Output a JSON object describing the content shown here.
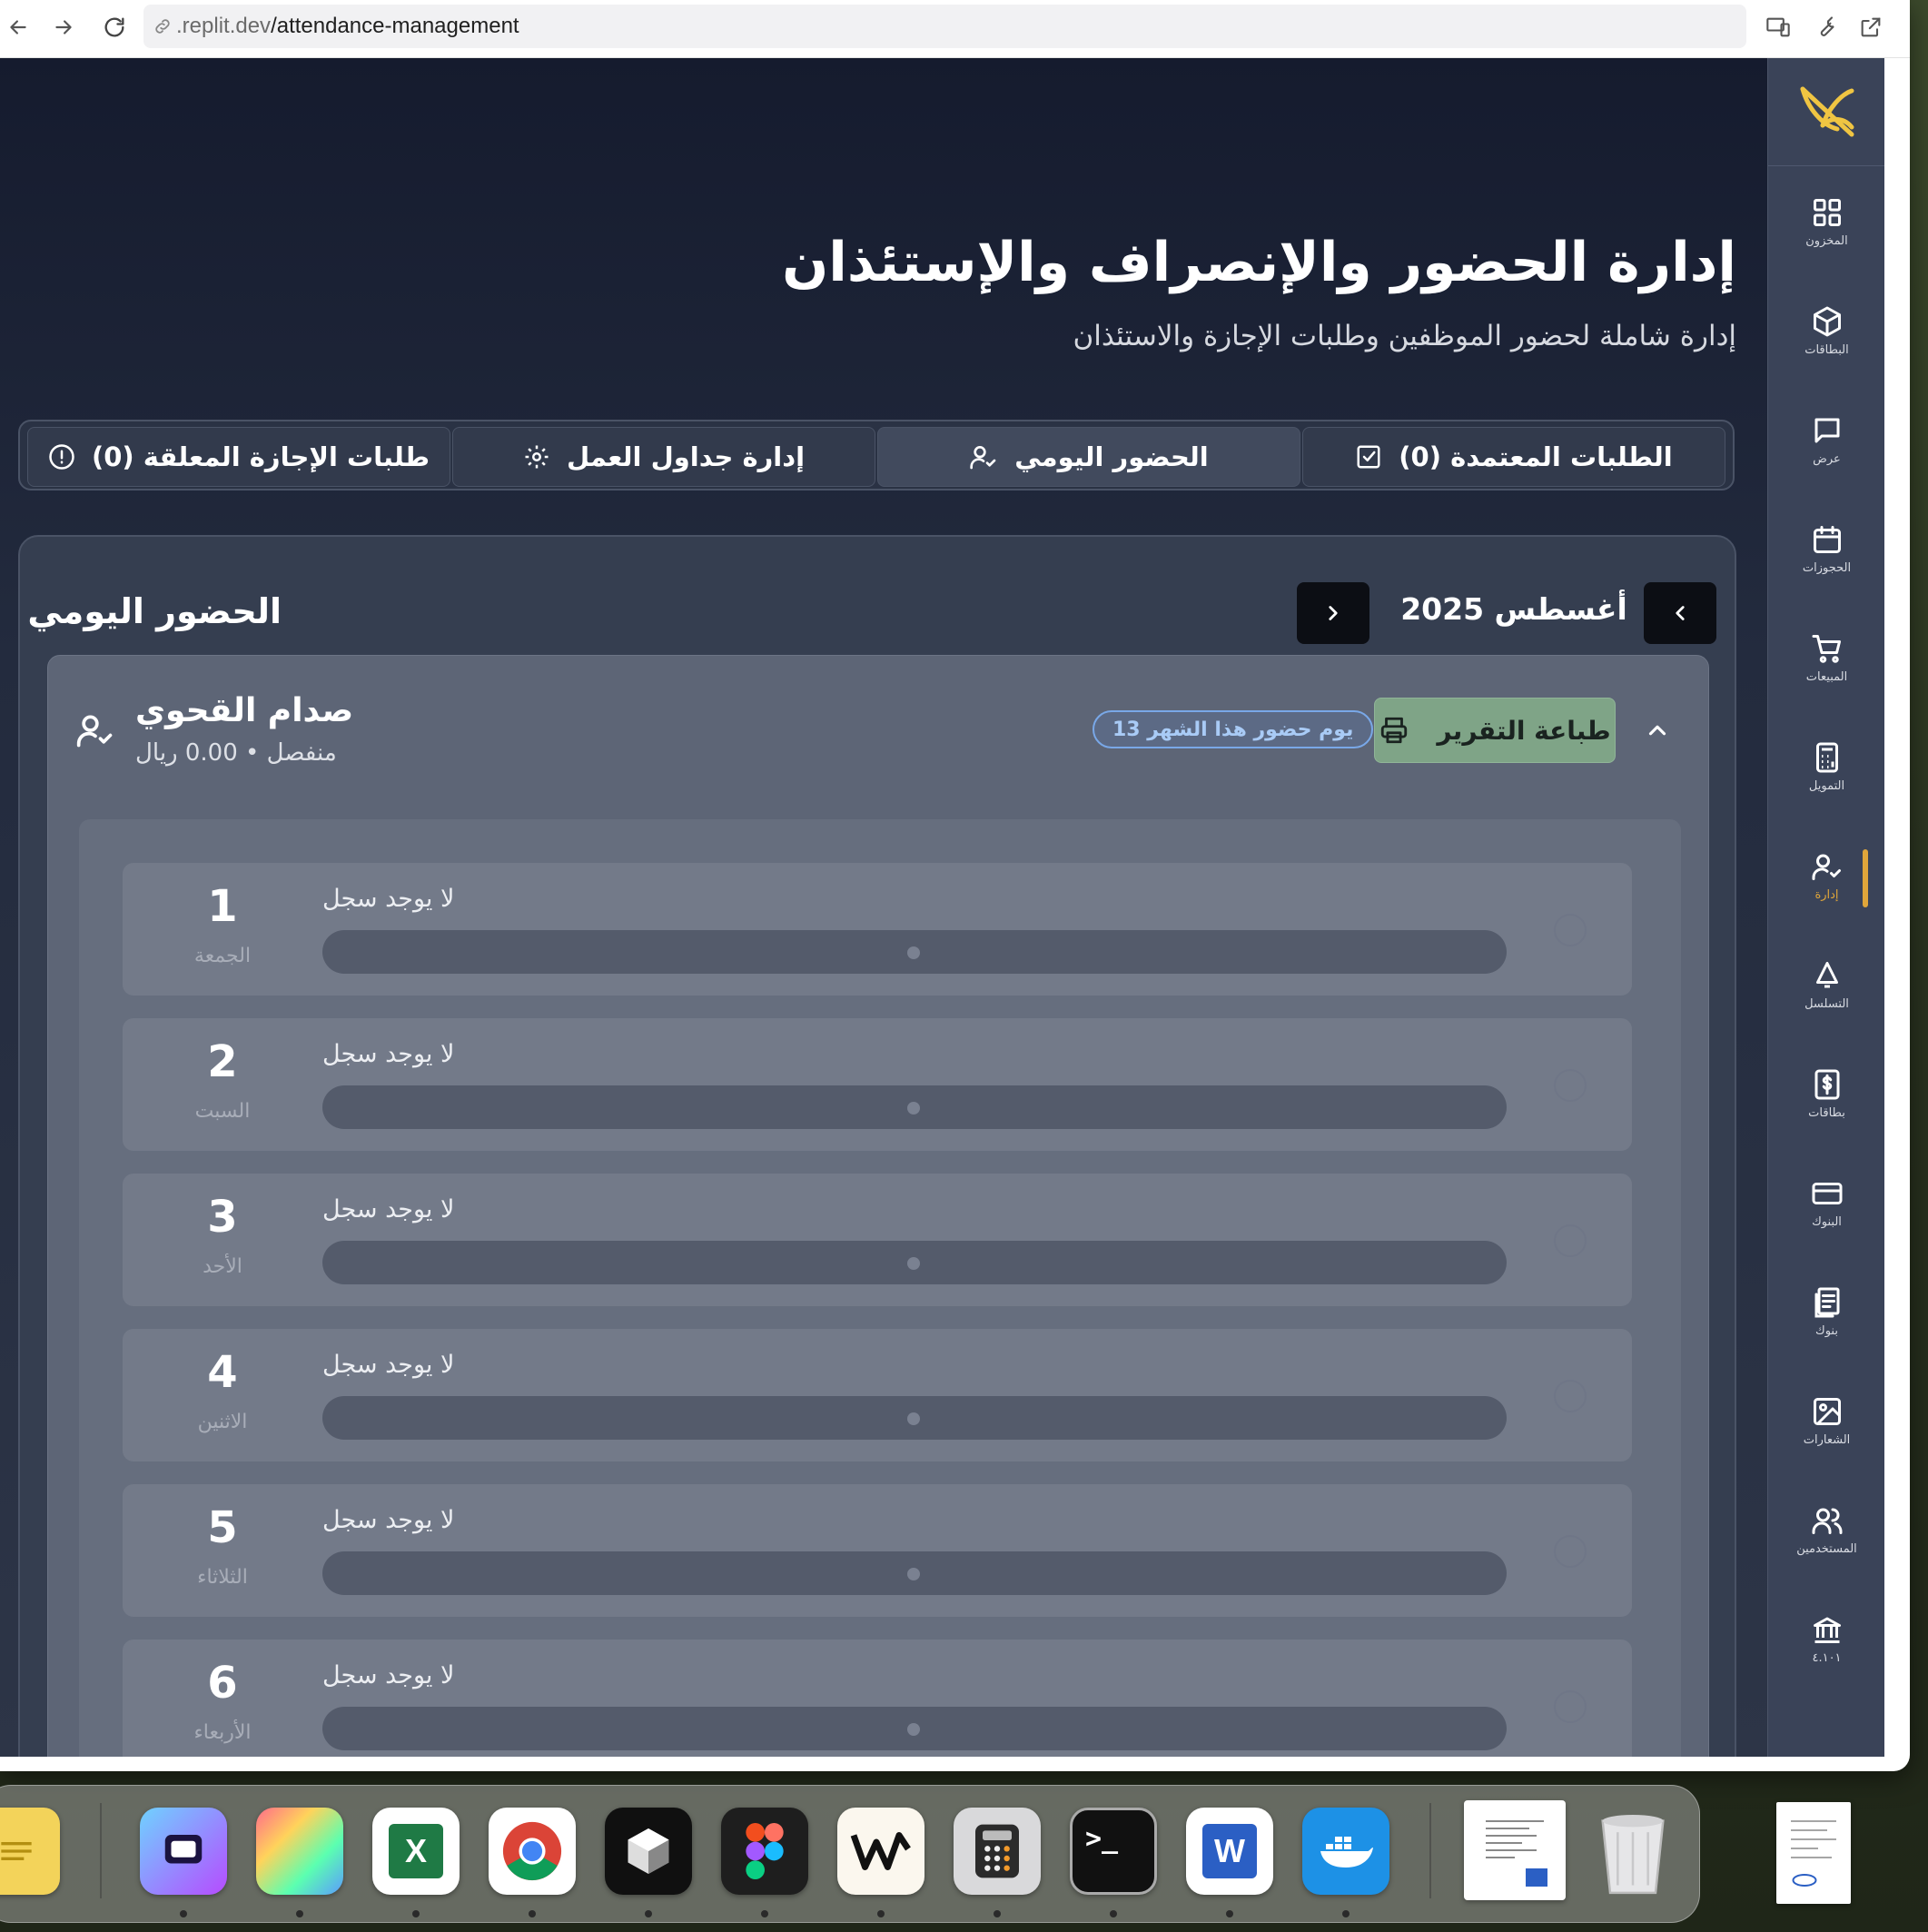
{
  "browser": {
    "url_host": ".replit.dev",
    "url_path": "/attendance-management"
  },
  "sidebar": {
    "items": [
      {
        "label": "المخزون",
        "icon": "grid-icon"
      },
      {
        "label": "البطاقات",
        "icon": "box-icon"
      },
      {
        "label": "عرض",
        "icon": "message-icon"
      },
      {
        "label": "الحجوزات",
        "icon": "calendar-icon"
      },
      {
        "label": "المبيعات",
        "icon": "cart-icon"
      },
      {
        "label": "التمويل",
        "icon": "calculator-icon"
      },
      {
        "label": "إدارة",
        "icon": "user-check-icon",
        "active": true
      },
      {
        "label": "التسلسل",
        "icon": "bell-icon"
      },
      {
        "label": "بطاقات",
        "icon": "dollar-file-icon"
      },
      {
        "label": "البنوك",
        "icon": "card-icon"
      },
      {
        "label": "بنوك",
        "icon": "receipt-icon"
      },
      {
        "label": "الشعارات",
        "icon": "image-icon"
      },
      {
        "label": "المستخدمين",
        "icon": "users-icon"
      },
      {
        "label": "٤.١٠١",
        "icon": "bank-icon"
      }
    ],
    "active_color": "#e0a63a"
  },
  "header": {
    "title": "إدارة الحضور والإنصراف والإستئذان",
    "subtitle": "إدارة شاملة لحضور الموظفين وطلبات الإجازة والاستئذان"
  },
  "tabs": [
    {
      "label": "الطلبات المعتمدة (0)",
      "icon": "check-square-icon"
    },
    {
      "label": "الحضور اليومي",
      "icon": "user-check-icon",
      "active": true
    },
    {
      "label": "إدارة جداول العمل",
      "icon": "gear-icon"
    },
    {
      "label": "طلبات الإجازة المعلقة (0)",
      "icon": "alert-circle-icon"
    }
  ],
  "daily": {
    "title": "الحضور اليومي",
    "month_label": "أغسطس 2025"
  },
  "employee": {
    "name": "صدام القحوي",
    "meta": "منفصل • 0.00 ريال",
    "attendance_badge": "يوم حضور هذا الشهر 13",
    "print_label": "طباعة التقرير"
  },
  "days": [
    {
      "num": "1",
      "name": "الجمعة",
      "status": "لا يوجد سجل"
    },
    {
      "num": "2",
      "name": "السبت",
      "status": "لا يوجد سجل"
    },
    {
      "num": "3",
      "name": "الأحد",
      "status": "لا يوجد سجل"
    },
    {
      "num": "4",
      "name": "الاثنين",
      "status": "لا يوجد سجل"
    },
    {
      "num": "5",
      "name": "الثلاثاء",
      "status": "لا يوجد سجل"
    },
    {
      "num": "6",
      "name": "الأربعاء",
      "status": "لا يوجد سجل"
    }
  ],
  "dock": {
    "apps": [
      "notes-icon",
      "screens-icon",
      "pixelmator-icon",
      "excel-icon",
      "chrome-icon",
      "unity-icon",
      "figma-icon",
      "warp-icon",
      "calculator-icon",
      "terminal-icon",
      "word-icon",
      "docker-icon",
      "document-preview-icon",
      "trash-icon"
    ],
    "excel_letter": "X",
    "word_letter": "W",
    "terminal_text": ">_"
  }
}
